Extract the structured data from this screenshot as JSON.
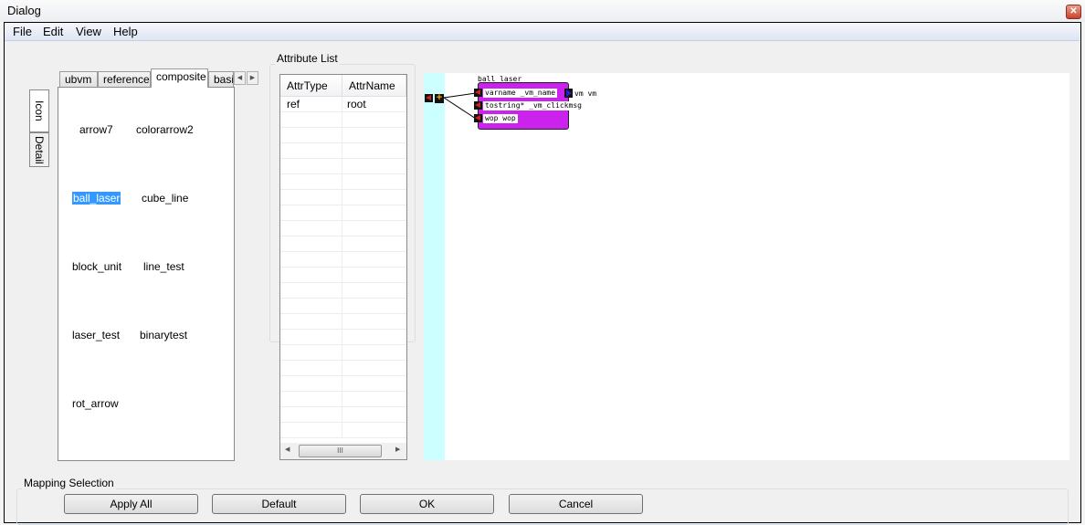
{
  "window": {
    "title": "Dialog",
    "close_icon": "close-icon"
  },
  "menu": [
    "File",
    "Edit",
    "View",
    "Help"
  ],
  "side_tabs": [
    "Icon",
    "Detail"
  ],
  "tabs": [
    "ubvm",
    "reference",
    "composite",
    "basic"
  ],
  "selected_tab": "composite",
  "icons": [
    "arrow7",
    "colorarrow2",
    "ball_laser",
    "cube_line",
    "block_unit",
    "line_test",
    "laser_test",
    "binarytest",
    "rot_arrow"
  ],
  "selected_icon": "ball_laser",
  "attribute_list": {
    "label": "Attribute List",
    "columns": [
      "AttrType",
      "AttrName"
    ],
    "rows": [
      [
        "ref",
        "root"
      ]
    ],
    "scroll_thumb": "III"
  },
  "canvas": {
    "node": {
      "title": "ball laser",
      "inputs": [
        "varname _vm_name",
        "tostring* _vm_clickmsg",
        "wop wop"
      ],
      "output": "vm vm"
    },
    "colors": {
      "node": "#cc22ee",
      "stripe": "#ccffff"
    }
  },
  "mapping": {
    "label": "Mapping Selection",
    "buttons": [
      "Apply All",
      "Default",
      "OK",
      "Cancel"
    ]
  }
}
